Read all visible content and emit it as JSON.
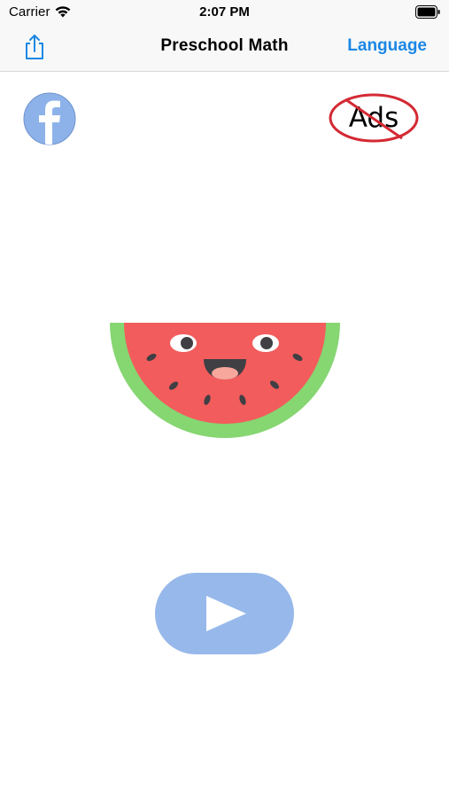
{
  "status_bar": {
    "carrier": "Carrier",
    "time": "2:07 PM",
    "icons": [
      "wifi-icon",
      "battery-icon"
    ]
  },
  "nav": {
    "title": "Preschool Math",
    "language_label": "Language",
    "share_icon": "share-icon"
  },
  "social": {
    "facebook_icon": "facebook-icon"
  },
  "no_ads": {
    "label": "Ads"
  },
  "mascot": {
    "icon": "watermelon-icon"
  },
  "play": {
    "icon": "play-icon"
  },
  "colors": {
    "accent": "#1b87e5",
    "facebook": "#8db2ea",
    "play_button": "#97b8ea",
    "no_ads_red": "#d42a34",
    "watermelon_rind": "#86d672",
    "watermelon_flesh": "#f25c5c"
  }
}
